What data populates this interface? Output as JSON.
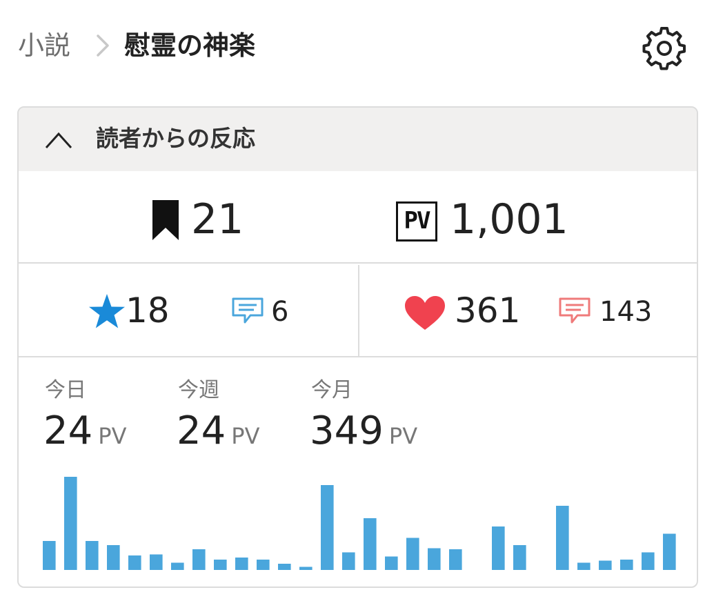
{
  "breadcrumb": {
    "parent": "小説",
    "current": "慰霊の神楽"
  },
  "card": {
    "title": "読者からの反応"
  },
  "counts": {
    "bookmarks": "21",
    "pv_icon_text": "PV",
    "pv_total": "1,001",
    "stars": "18",
    "star_comments": "6",
    "hearts": "361",
    "heart_comments": "143"
  },
  "colors": {
    "star": "#1a8ad8",
    "heart": "#f0424f",
    "comment_blue": "#4aa6dc",
    "comment_red": "#ef7a7a",
    "bar": "#4aa6dc"
  },
  "stats": [
    {
      "label": "今日",
      "value": "24",
      "unit": "PV"
    },
    {
      "label": "今週",
      "value": "24",
      "unit": "PV"
    },
    {
      "label": "今月",
      "value": "349",
      "unit": "PV"
    }
  ],
  "chart_data": {
    "type": "bar",
    "values": [
      28,
      90,
      28,
      24,
      14,
      15,
      7,
      20,
      10,
      12,
      10,
      6,
      3,
      82,
      17,
      50,
      13,
      31,
      21,
      20,
      0,
      42,
      24,
      0,
      62,
      7,
      9,
      10,
      17,
      35
    ],
    "ylim": [
      0,
      100
    ]
  }
}
